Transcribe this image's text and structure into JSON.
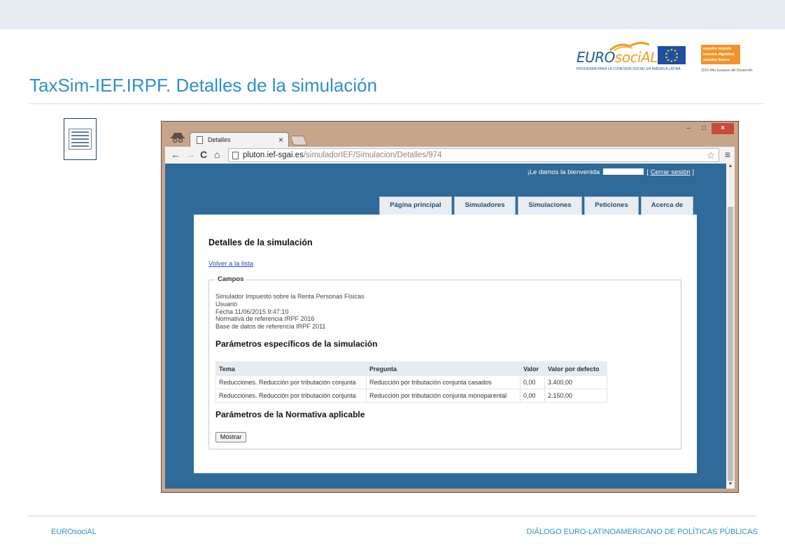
{
  "slide": {
    "title": "TaxSim-IEF.IRPF. Detalles de la simulación",
    "footer_left": "EUROsociAL",
    "footer_right": "DIÁLOGO EURO-LATINOAMERICANO DE POLÍTICAS PÚBLICAS"
  },
  "logos": {
    "eurosocial_prefix": "EURO",
    "eurosocial_accent": "sociAL",
    "eurosocial_sub": "PROGRAMA PARA LA COHESIÓN SOCIAL EN AMÉRICA LATINA",
    "badge_lines": [
      "nuestro mundo",
      "nuestra dignidad",
      "nuestro futuro"
    ],
    "badge_sub": "2015 Año Europeo del Desarrollo"
  },
  "browser": {
    "tab_title": "Detalles",
    "tab_close": "×",
    "url_host": "pluton.ief-sgai.es",
    "url_path": "/simuladorIEF/Simulacion/Detalles/974",
    "window_controls": {
      "minimize": "–",
      "maximize": "□",
      "close": "×"
    },
    "nav": {
      "back": "←",
      "forward": "→",
      "reload": "C",
      "home": "⌂",
      "star": "☆",
      "menu": "≡"
    }
  },
  "site": {
    "welcome_text": "¡Le damos la bienvenida",
    "logout_open": "[",
    "logout_label": "Cerrar sesión",
    "logout_close": "]",
    "menu": [
      "Página principal",
      "Simuladores",
      "Simulaciones",
      "Peticiones",
      "Acerca de"
    ]
  },
  "details": {
    "title": "Detalles de la simulación",
    "back_link": "Volver a la lista",
    "legend": "Campos",
    "fields": [
      "Simulador Impuesto sobre la Renta Personas Físicas",
      "Usuario",
      "Fecha 11/06/2015 9:47:10",
      "Normativa de referencia IRPF 2016",
      "Base de datos de referencia IRPF 2011"
    ],
    "params_title": "Parámetros específicos de la simulación",
    "table": {
      "headers": [
        "Tema",
        "Pregunta",
        "Valor",
        "Valor por defecto"
      ],
      "rows": [
        [
          "Reducciones. Reducción por tributación conjunta",
          "Reducción por tributación conjunta casados",
          "0,00",
          "3.400,00"
        ],
        [
          "Reducciones. Reducción por tributación conjunta",
          "Reducción por tributación conjunta monoparental",
          "0,00",
          "2.150,00"
        ]
      ]
    },
    "normativa_title": "Parámetros de la Normativa aplicable",
    "show_button": "Mostrar"
  }
}
